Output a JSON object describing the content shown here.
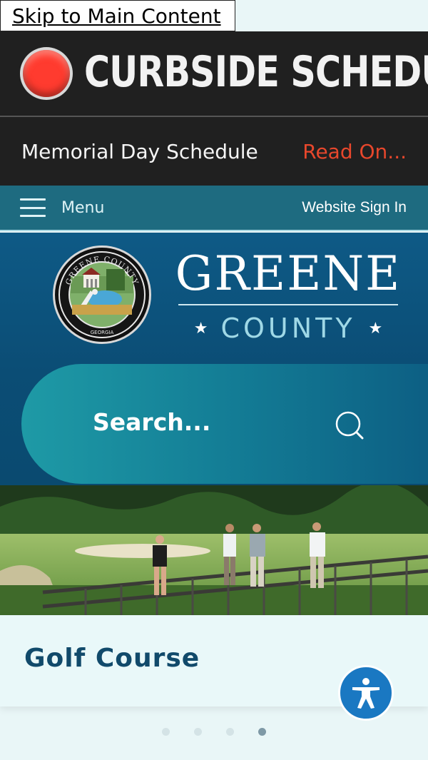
{
  "skip_link": "Skip to Main Content",
  "alert": {
    "title": "CURBSIDE SCHEDULE",
    "notice_text": "Memorial Day Schedule",
    "read_on": "Read On..."
  },
  "topnav": {
    "menu_label": "Menu",
    "signin_label": "Website Sign In"
  },
  "header": {
    "county_name": "GREENE",
    "county_word": "COUNTY",
    "seal_text_top": "GREENE COUNTY",
    "seal_text_bottom": "GEORGIA"
  },
  "search": {
    "placeholder": "Search..."
  },
  "slide": {
    "title": "Golf Course",
    "total": 4,
    "active_index": 3
  },
  "colors": {
    "alert_bg": "#202020",
    "alert_dot": "#ff3b2f",
    "read_on": "#e8472c",
    "topnav": "#1e6b80",
    "header": "#0e5a86",
    "caption_title": "#114a6b",
    "accessibility": "#1a78c2"
  },
  "icons": {
    "alert": "red-alert-dot-icon",
    "menu": "hamburger-icon",
    "search": "search-icon",
    "accessibility": "accessibility-person-icon"
  }
}
